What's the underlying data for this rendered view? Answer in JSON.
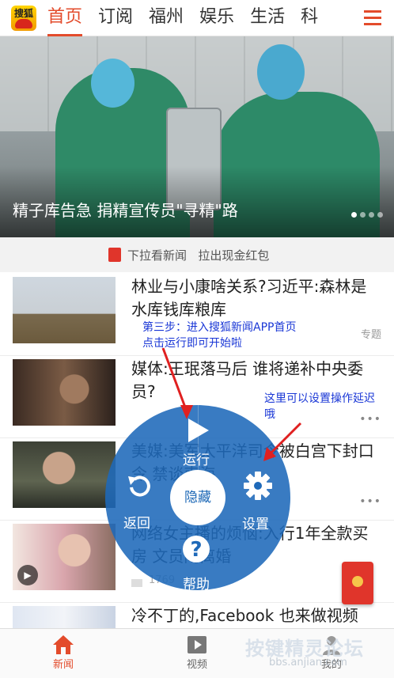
{
  "header": {
    "logo_text": "搜狐",
    "tabs": [
      {
        "label": "首页",
        "active": true
      },
      {
        "label": "订阅",
        "active": false
      },
      {
        "label": "福州",
        "active": false
      },
      {
        "label": "娱乐",
        "active": false
      },
      {
        "label": "生活",
        "active": false
      },
      {
        "label": "科",
        "active": false
      }
    ],
    "accent_color": "#e34b2b"
  },
  "hero": {
    "caption": "精子库告急 捐精宣传员\"寻精\"路",
    "slide_count": 4,
    "active_slide": 1
  },
  "pull_hint": {
    "left": "下拉看新闻",
    "right": "拉出现金红包"
  },
  "news": [
    {
      "title": "林业与小康啥关系?习近平:森林是水库钱库粮库",
      "tag": "专题",
      "comments": ""
    },
    {
      "title": "媒体:王珉落马后 谁将递补中央委员?",
      "tag": "",
      "comments": ""
    },
    {
      "title": "美媒:美军太平洋司令被白宫下封口令 禁谈南海",
      "tag": "",
      "comments": ""
    },
    {
      "title": "网络女主播的烦恼:入行1年全款买房 文员闹离婚",
      "tag": "",
      "comments": "1769"
    },
    {
      "title": "冷不丁的,Facebook 也来做视频",
      "tag": "",
      "comments": ""
    }
  ],
  "annotations": {
    "step": "第三步：进入搜狐新闻APP首页\n点击运行即可开始啦",
    "delay": "这里可以设置操作延迟\n哦"
  },
  "radial_menu": {
    "run": "运行",
    "back": "返回",
    "hide": "隐藏",
    "settings": "设置",
    "help": "帮助"
  },
  "bottom_nav": [
    {
      "label": "新闻",
      "active": true
    },
    {
      "label": "视频",
      "active": false
    },
    {
      "label": "我的",
      "active": false
    }
  ],
  "watermark": {
    "text": "按键精灵论坛",
    "url": "bbs.anjian.com"
  }
}
